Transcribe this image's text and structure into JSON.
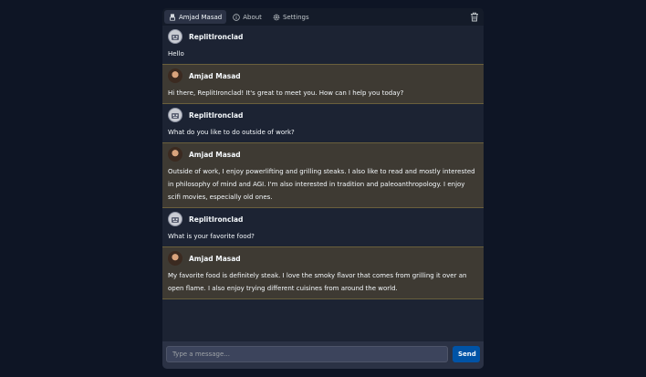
{
  "topbar": {
    "tabs": [
      {
        "label": "Amjad Masad",
        "icon": "user-robot-icon",
        "active": true
      },
      {
        "label": "About",
        "icon": "info-icon",
        "active": false
      },
      {
        "label": "Settings",
        "icon": "gear-icon",
        "active": false
      }
    ],
    "trash_icon": "trash-icon"
  },
  "messages": [
    {
      "author": "ReplitIronclad",
      "role": "bot",
      "text": "Hello"
    },
    {
      "author": "Amjad Masad",
      "role": "user",
      "text": "Hi there, ReplitIronclad! It's great to meet you. How can I help you today?"
    },
    {
      "author": "ReplitIronclad",
      "role": "bot",
      "text": "What do you like to do outside of work?"
    },
    {
      "author": "Amjad Masad",
      "role": "user",
      "text": "Outside of work, I enjoy powerlifting and grilling steaks. I also like to read and mostly interested in philosophy of mind and AGI. I'm also interested in tradition and paleoanthropology. I enjoy scifi movies, especially old ones."
    },
    {
      "author": "ReplitIronclad",
      "role": "bot",
      "text": "What is your favorite food?"
    },
    {
      "author": "Amjad Masad",
      "role": "user",
      "text": "My favorite food is definitely steak. I love the smoky flavor that comes from grilling it over an open flame. I also enjoy trying different cuisines from around the world."
    }
  ],
  "composer": {
    "placeholder": "Type a message...",
    "value": "",
    "send_label": "Send"
  },
  "colors": {
    "page_bg": "#0e1525",
    "panel_bg": "#1c2333",
    "user_msg_bg": "#3e3a33",
    "user_msg_border": "#6a5f3c",
    "send_button": "#0053a6"
  }
}
